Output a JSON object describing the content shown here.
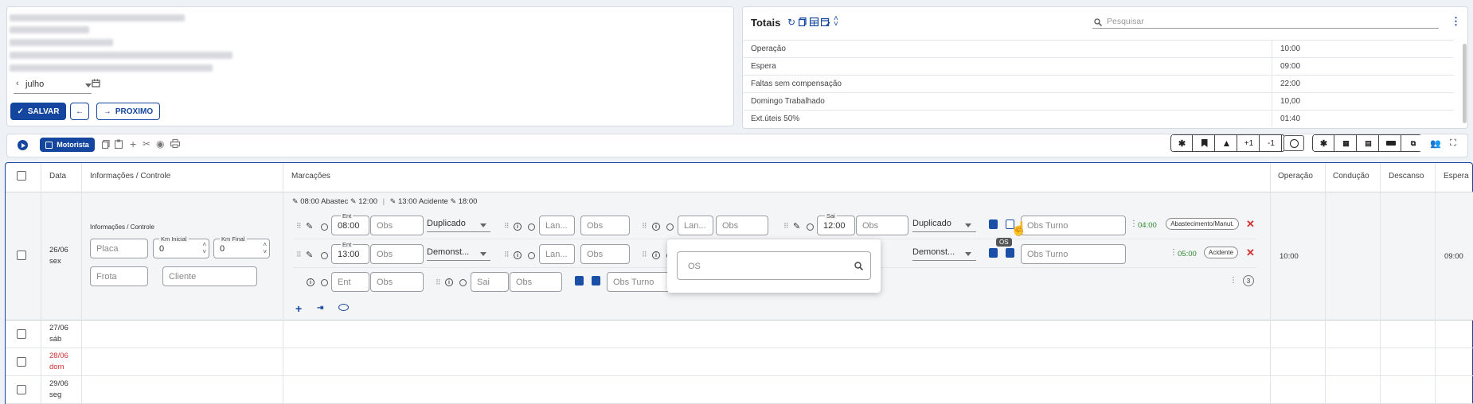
{
  "header": {
    "month": "julho",
    "save_label": "SALVAR",
    "next_label": "PROXIMO"
  },
  "totals": {
    "title": "Totais",
    "search_placeholder": "Pesquisar",
    "rows": [
      {
        "label": "Operação",
        "value": "10:00"
      },
      {
        "label": "Espera",
        "value": "09:00"
      },
      {
        "label": "Faltas sem compensação",
        "value": "22:00"
      },
      {
        "label": "Domingo Trabalhado",
        "value": "10,00"
      },
      {
        "label": "Ext.úteis 50%",
        "value": "01:40"
      }
    ]
  },
  "toolbar": {
    "motorista_label": "Motorista",
    "right_buttons": [
      "+1",
      "-1"
    ]
  },
  "table": {
    "headers": {
      "data": "Data",
      "info": "Informações / Controle",
      "marcacoes": "Marcações",
      "operacao": "Operação",
      "conducao": "Condução",
      "descanso": "Descanso",
      "espera": "Espera"
    },
    "row1": {
      "date": "26/06",
      "weekday": "sex",
      "info_title": "Informações / Controle",
      "placa_placeholder": "Placa",
      "km_inicial_label": "Km Inicial",
      "km_inicial_value": "0",
      "km_final_label": "Km Final",
      "km_final_value": "0",
      "frota_placeholder": "Frota",
      "cliente_placeholder": "Cliente",
      "summary": {
        "a": "08:00 Abastec",
        "b": "12:00",
        "sep": "|",
        "c": "13:00 Acidente",
        "d": "18:00"
      },
      "ent_label": "Ent",
      "sai_label": "Sai",
      "line1": {
        "ent_time": "08:00",
        "obs": "Obs",
        "type": "Duplicado",
        "lan": "Lan...",
        "sai_time": "12:00",
        "type2": "Duplicado",
        "obs_turno": "Obs Turno",
        "duration": "04:00",
        "tag": "Abastecimento/Manut."
      },
      "line2": {
        "ent_time": "13:00",
        "obs": "Obs",
        "type": "Demonst...",
        "lan": "Lan...",
        "type2": "Demonst...",
        "obs_turno": "Obs Turno",
        "duration": "05:00",
        "tag": "Acidente"
      },
      "line3": {
        "ent": "Ent",
        "obs": "Obs",
        "sai": "Sai",
        "obs_turno": "Obs Turno",
        "count": "3"
      },
      "operacao": "10:00",
      "espera": "09:00"
    },
    "rows": [
      {
        "date": "27/06",
        "weekday": "sáb"
      },
      {
        "date": "28/06",
        "weekday": "dom"
      },
      {
        "date": "29/06",
        "weekday": "seg"
      }
    ]
  },
  "popup": {
    "placeholder": "OS",
    "tooltip": "OS"
  },
  "colors": {
    "primary": "#1446a0",
    "sunday": "#d32f2f",
    "duration": "#2e8b2e"
  }
}
